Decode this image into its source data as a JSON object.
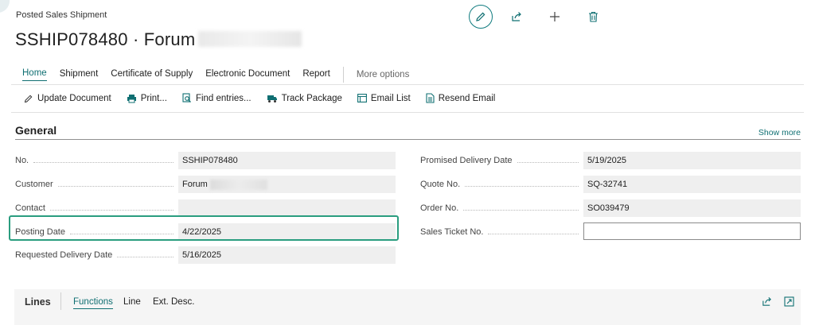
{
  "breadcrumb": "Posted Sales Shipment",
  "title": "SSHIP078480 · Forum",
  "nav": {
    "tabs": [
      "Home",
      "Shipment",
      "Certificate of Supply",
      "Electronic Document",
      "Report"
    ],
    "more": "More options"
  },
  "actions": [
    "Update Document",
    "Print...",
    "Find entries...",
    "Track Package",
    "Email List",
    "Resend Email"
  ],
  "general": {
    "heading": "General",
    "show_more": "Show more",
    "left": [
      {
        "label": "No.",
        "value": "SSHIP078480"
      },
      {
        "label": "Customer",
        "value": "Forum"
      },
      {
        "label": "Contact",
        "value": ""
      },
      {
        "label": "Posting Date",
        "value": "4/22/2025"
      },
      {
        "label": "Requested Delivery Date",
        "value": "5/16/2025"
      }
    ],
    "right": [
      {
        "label": "Promised Delivery Date",
        "value": "5/19/2025"
      },
      {
        "label": "Quote No.",
        "value": "SQ-32741"
      },
      {
        "label": "Order No.",
        "value": "SO039479"
      },
      {
        "label": "Sales Ticket No.",
        "value": ""
      }
    ]
  },
  "lines": {
    "title": "Lines",
    "tabs": [
      "Functions",
      "Line",
      "Ext. Desc."
    ]
  },
  "colors": {
    "accent": "#0f6f72",
    "highlight": "#2a9d7f"
  }
}
